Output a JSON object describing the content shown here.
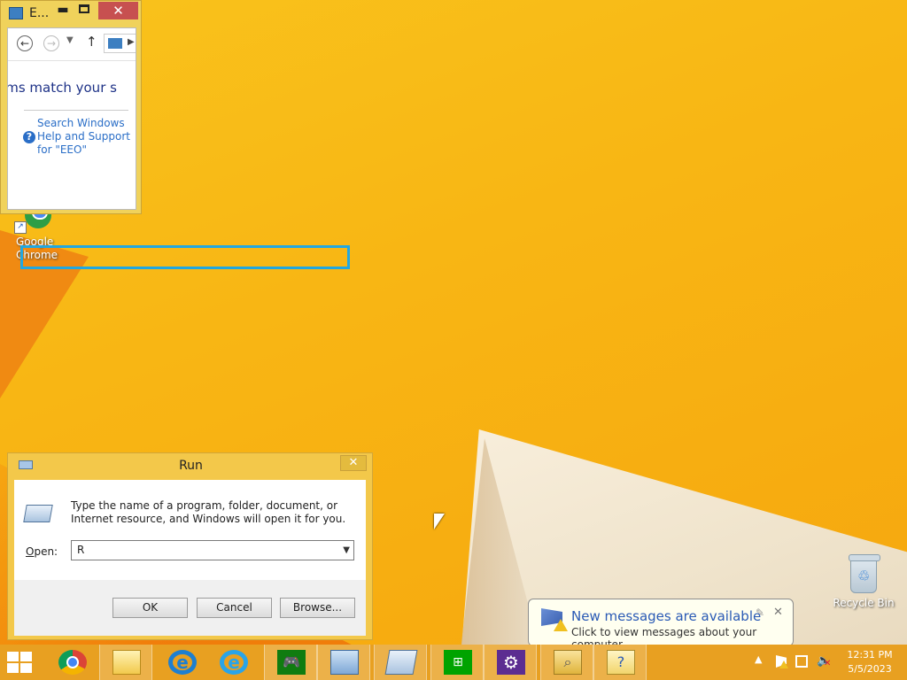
{
  "explorer": {
    "title": "E...",
    "close_label": "✕",
    "no_match_text": "ems match your s",
    "help_link": "Search Windows Help and Support for \"EEO\""
  },
  "desktop": {
    "chrome_label": "Google Chrome",
    "recycle_label": "Recycle Bin"
  },
  "run_dialog": {
    "title": "Run",
    "close_label": "✕",
    "description": "Type the name of a program, folder, document, or Internet resource, and Windows will open it for you.",
    "open_label_prefix": "O",
    "open_label_rest": "pen:",
    "input_value": "R",
    "ok_label": "OK",
    "cancel_label": "Cancel",
    "browse_label": "Browse..."
  },
  "notification": {
    "title": "New messages are available",
    "message": "Click to view messages about your computer."
  },
  "taskbar": {
    "time": "12:31 PM",
    "date": "5/5/2023",
    "items": [
      "chrome-icon",
      "file-explorer-icon",
      "internet-explorer-icon",
      "internet-explorer-icon",
      "xbox-games-icon",
      "control-panel-icon",
      "run-icon",
      "store-icon",
      "settings-gear-icon",
      "search-results-icon",
      "help-icon"
    ]
  },
  "colors": {
    "wallpaper": "#f8b614",
    "taskbar": "#e8a021",
    "highlight": "#22a7e0",
    "link": "#2a6ec7"
  }
}
